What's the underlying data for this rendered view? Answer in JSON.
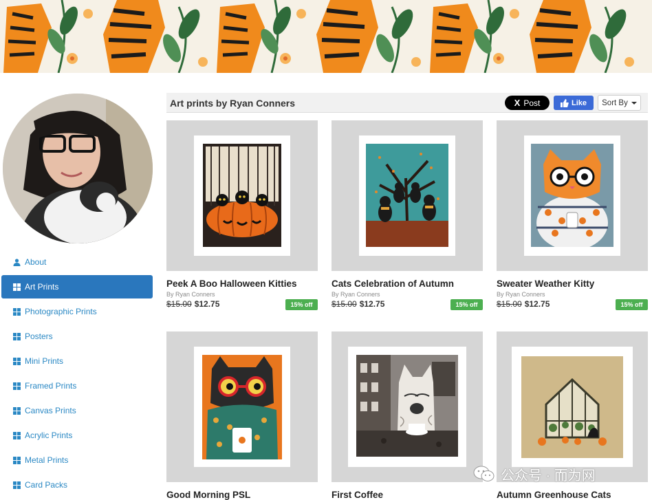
{
  "toolbar": {
    "title": "Art prints by Ryan Conners",
    "post_label": "Post",
    "like_label": "Like",
    "sort_label": "Sort By"
  },
  "sidebar": {
    "items": [
      {
        "label": "About",
        "icon": "user-icon",
        "active": false
      },
      {
        "label": "Art Prints",
        "icon": "grid-icon",
        "active": true
      },
      {
        "label": "Photographic Prints",
        "icon": "grid-icon",
        "active": false
      },
      {
        "label": "Posters",
        "icon": "grid-icon",
        "active": false
      },
      {
        "label": "Mini Prints",
        "icon": "grid-icon",
        "active": false
      },
      {
        "label": "Framed Prints",
        "icon": "grid-icon",
        "active": false
      },
      {
        "label": "Canvas Prints",
        "icon": "grid-icon",
        "active": false
      },
      {
        "label": "Acrylic Prints",
        "icon": "grid-icon",
        "active": false
      },
      {
        "label": "Metal Prints",
        "icon": "grid-icon",
        "active": false
      },
      {
        "label": "Card Packs",
        "icon": "grid-icon",
        "active": false
      }
    ]
  },
  "products": [
    {
      "title": "Peek A Boo Halloween Kitties",
      "artist": "By Ryan Conners",
      "old_price": "$15.00",
      "price": "$12.75",
      "badge": "15% off"
    },
    {
      "title": "Cats Celebration of Autumn",
      "artist": "By Ryan Conners",
      "old_price": "$15.00",
      "price": "$12.75",
      "badge": "15% off"
    },
    {
      "title": "Sweater Weather Kitty",
      "artist": "By Ryan Conners",
      "old_price": "$15.00",
      "price": "$12.75",
      "badge": "15% off"
    },
    {
      "title": "Good Morning PSL"
    },
    {
      "title": "First Coffee"
    },
    {
      "title": "Autumn Greenhouse Cats"
    }
  ],
  "watermark": "公众号 · 而为网",
  "colors": {
    "accent": "#2a77bd",
    "link": "#2a88c4",
    "badge": "#4caf50",
    "tiger": "#f08a1c"
  }
}
